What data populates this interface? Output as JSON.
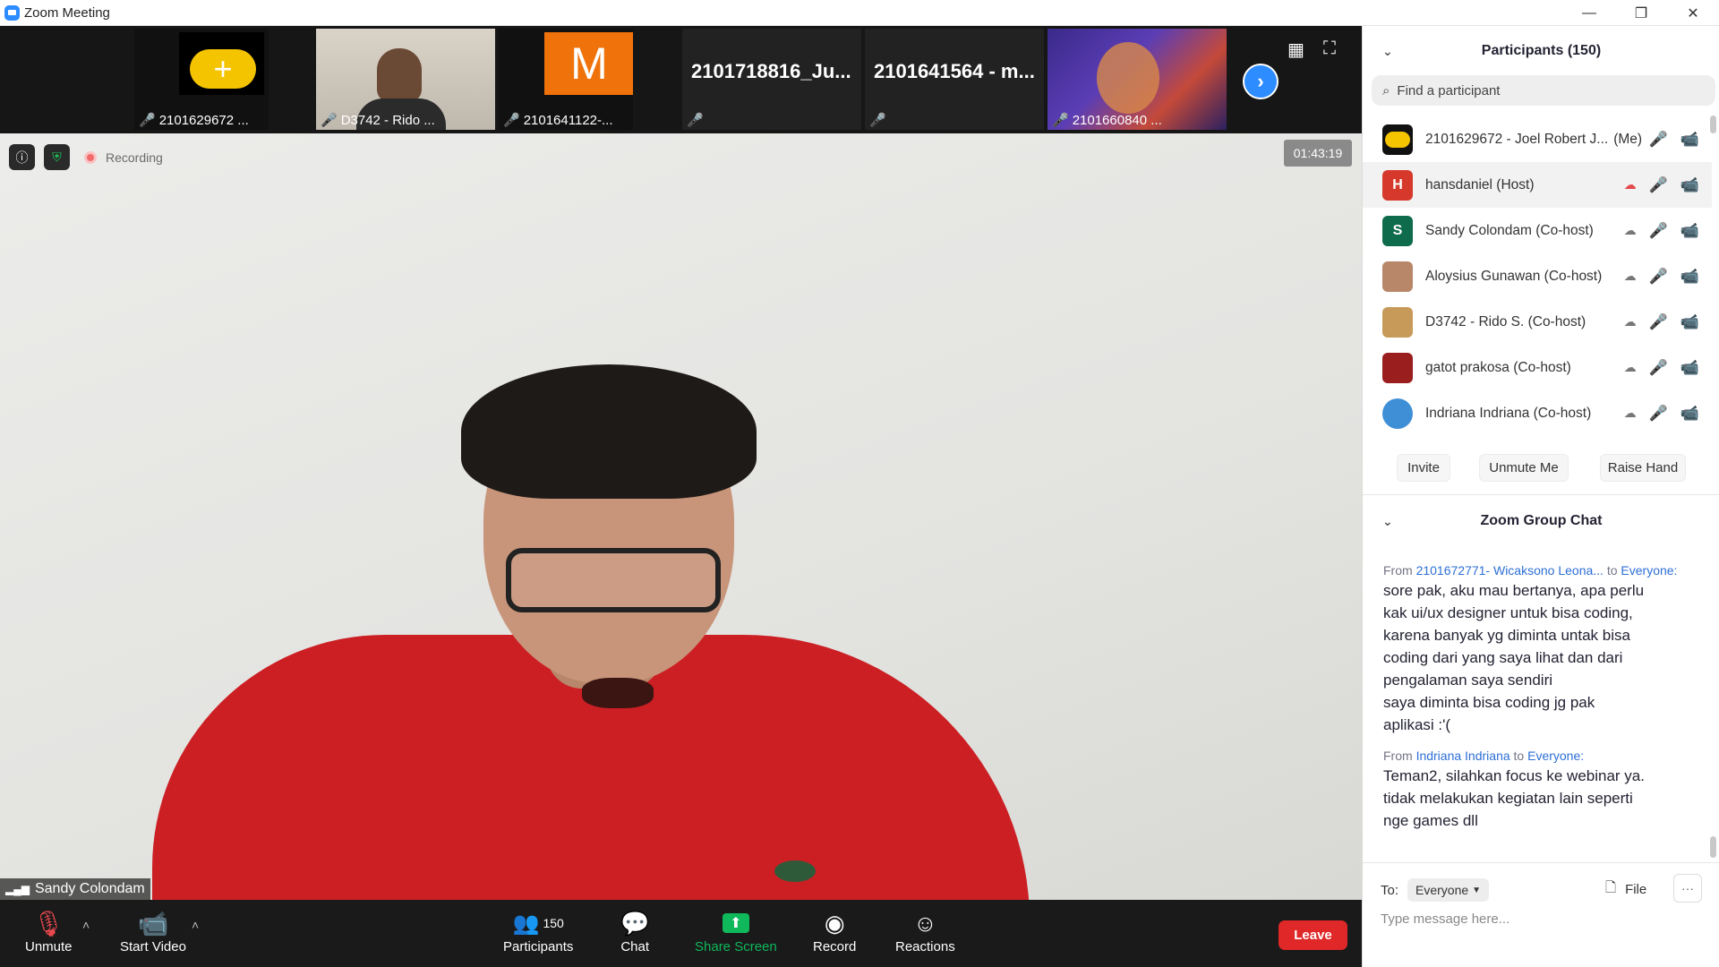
{
  "window": {
    "title": "Zoom Meeting",
    "minimize_glyph": "—",
    "restore_glyph": "❐",
    "close_glyph": "✕"
  },
  "strip": {
    "thumbnails": [
      {
        "name": "2101629672 ...",
        "big_label": ""
      },
      {
        "name": "D3742 - Rido ...",
        "big_label": ""
      },
      {
        "name": "2101641122-...",
        "big_label": "M"
      },
      {
        "name": "",
        "big_label": "2101718816_Ju..."
      },
      {
        "name": "",
        "big_label": "2101641564 - m..."
      },
      {
        "name": "2101660840 ...",
        "big_label": ""
      }
    ],
    "next_glyph": "›",
    "gallery_glyph": "▦",
    "fullscreen_glyph": "⛶"
  },
  "video": {
    "recording_label": "Recording",
    "timer": "01:43:19",
    "speaker_name": "Sandy Colondam"
  },
  "toolbar": {
    "unmute_label": "Unmute",
    "start_video_label": "Start Video",
    "participants_label": "Participants",
    "participants_count": "150",
    "chat_label": "Chat",
    "share_screen_label": "Share Screen",
    "record_label": "Record",
    "reactions_label": "Reactions",
    "leave_label": "Leave",
    "colors": {
      "share_green": "#0fb85b",
      "leave_red": "#e02828"
    }
  },
  "participants_panel": {
    "title": "Participants (150)",
    "search_placeholder": "Find a participant",
    "items": [
      {
        "name": "2101629672 - Joel Robert J...",
        "suffix": "(Me)",
        "avatar": "",
        "avatar_color": "#f5c400"
      },
      {
        "name": "hansdaniel (Host)",
        "suffix": "",
        "avatar": "H",
        "avatar_color": "#d6392b"
      },
      {
        "name": "Sandy Colondam (Co-host)",
        "suffix": "",
        "avatar": "S",
        "avatar_color": "#0e6b4b"
      },
      {
        "name": "Aloysius Gunawan (Co-host)",
        "suffix": "",
        "avatar": "",
        "avatar_color": "#b8876a"
      },
      {
        "name": "D3742 - Rido S. (Co-host)",
        "suffix": "",
        "avatar": "",
        "avatar_color": "#c79a5a"
      },
      {
        "name": "gatot prakosa (Co-host)",
        "suffix": "",
        "avatar": "",
        "avatar_color": "#9a1e1e"
      },
      {
        "name": "Indriana Indriana (Co-host)",
        "suffix": "",
        "avatar": "",
        "avatar_color": "#3f8fd6"
      }
    ],
    "invite_label": "Invite",
    "unmute_me_label": "Unmute Me",
    "raise_hand_label": "Raise Hand"
  },
  "chat_panel": {
    "title": "Zoom Group Chat",
    "messages": [
      {
        "from_prefix": "From",
        "sender": "2101672771- Wicaksono Leona...",
        "to_prefix": "to",
        "recipient": "Everyone:",
        "lines": [
          "sore pak, aku mau bertanya, apa perlu",
          "kak ui/ux designer untuk bisa coding,",
          "karena banyak yg diminta untak bisa",
          "coding dari yang saya lihat dan dari",
          "pengalaman saya sendiri",
          "saya diminta bisa coding jg pak",
          "aplikasi :'("
        ]
      },
      {
        "from_prefix": "From",
        "sender": "Indriana Indriana",
        "to_prefix": "to",
        "recipient": "Everyone:",
        "lines": [
          "Teman2, silahkan focus ke webinar ya.",
          "tidak melakukan kegiatan lain seperti",
          "nge games dll"
        ]
      }
    ],
    "to_label": "To:",
    "to_value": "Everyone",
    "file_label": "File",
    "more_glyph": "···",
    "input_placeholder": "Type message here..."
  }
}
